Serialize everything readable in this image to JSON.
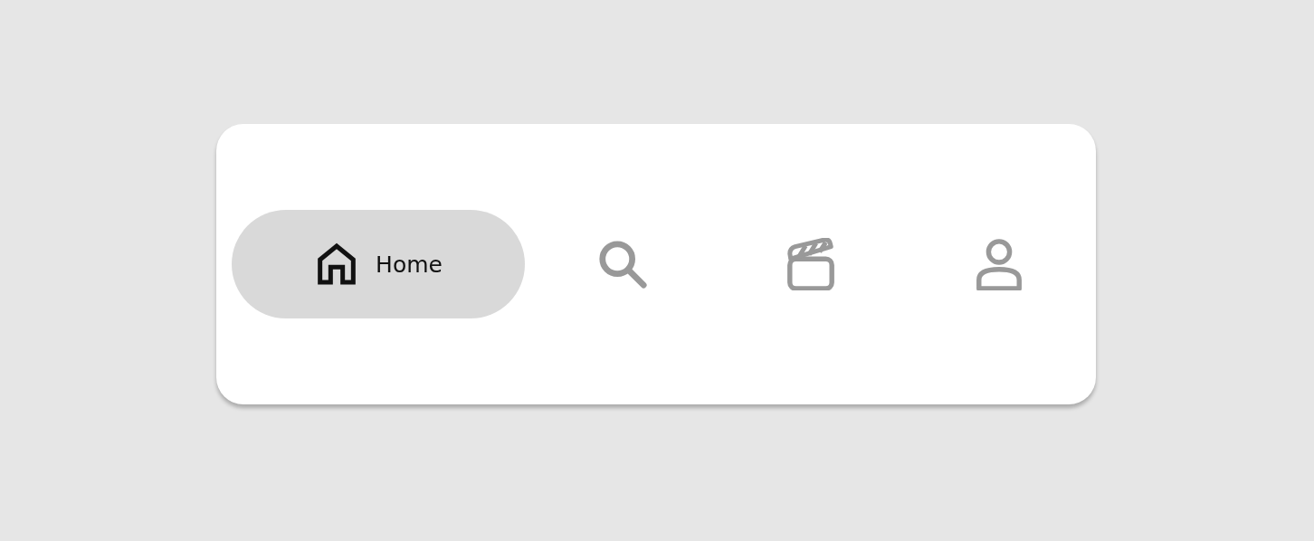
{
  "nav_items": [
    {
      "kind": "home",
      "label": "Home",
      "selected": true
    },
    {
      "kind": "search",
      "selected": false
    },
    {
      "kind": "clapper",
      "selected": false
    },
    {
      "kind": "person",
      "selected": false
    }
  ]
}
